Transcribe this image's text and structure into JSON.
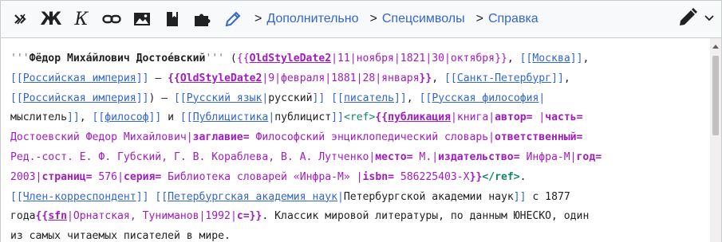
{
  "toolbar": {
    "tabs": [
      {
        "label": "Дополнительно"
      },
      {
        "label": "Спецсимволы"
      },
      {
        "label": "Справка"
      }
    ],
    "bold_label": "Ж",
    "italic_label": "К",
    "accent_color": "#3366cc"
  },
  "editor": {
    "l1": {
      "q_open": "'''",
      "bold_name": "Фёдор Миха́йлович Достое́вский",
      "q_close": "'''",
      "p_open": " (",
      "t1_open": "{{",
      "t1_name": "OldStyleDate2",
      "t1_args": "|11|ноября|1821|30|октября",
      "t1_close": "}}",
      "sep": ", ",
      "lk_open": "[[",
      "lk_text": "Москва",
      "lk_close": "]]",
      "end": ","
    },
    "l2": {
      "lk1_open": "[[",
      "lk1_text": "Российская империя",
      "lk1_close": "]]",
      "dash": " — ",
      "t_open": "{{",
      "t_name": "OldStyleDate2",
      "t_args": "|9|февраля|1881|28|января",
      "t_close": "}}",
      "sep": ", ",
      "lk2_open": "[[",
      "lk2_text": "Санкт-Петербург",
      "lk2_close": "]]",
      "end": ","
    },
    "l3": {
      "lk1_open": "[[",
      "lk1_text": "Российская империя",
      "lk1_close": "]]",
      "dash": ") — ",
      "lk2_open": "[[",
      "lk2_text": "Русский язык",
      "lk2_pipe": "|",
      "lk2_label": "русский",
      "lk2_close": "]]",
      "sep1": " ",
      "lk3_open": "[[",
      "lk3_text": "писатель",
      "lk3_close": "]]",
      "sep2": ", ",
      "lk4_open": "[[",
      "lk4_text": "Русская философия",
      "lk4_pipe": "|"
    },
    "l4": {
      "text1": "мыслитель",
      "lk1_close": "]]",
      "sep1": ", ",
      "lk2_open": "[[",
      "lk2_text": "философ",
      "lk2_close": "]]",
      "and": " и ",
      "lk3_open": "[[",
      "lk3_text": "Публицистика",
      "lk3_pipe": "|",
      "lk3_label": "публицист",
      "lk3_close": "]]",
      "ref_open": "<ref>",
      "t_open": "{{",
      "t_name": "публикация",
      "t_rest1": "|книга|",
      "p1": "автор=",
      "t_rest2": " |",
      "p2": "часть="
    },
    "l5": {
      "text1": "Достоевский Федор Михайлович",
      "pipe1": "|",
      "p1": "заглавие=",
      "text2": " Философский энциклопедический словарь",
      "pipe2": "|",
      "p2": "ответственный="
    },
    "l6": {
      "text1": "Ред.-сост. Е. Ф. Губский, Г. В. Кораблева, В. А. Лутченко",
      "pipe1": "|",
      "p1": "место=",
      "text2": " М.",
      "pipe2": "|",
      "p2": "издательство=",
      "text3": " Инфра-М",
      "pipe3": "|",
      "p3": "год="
    },
    "l7": {
      "text1": "2003",
      "pipe1": "|",
      "p1": "страниц=",
      "text2": " 576",
      "pipe2": "|",
      "p2": "серия=",
      "text3": " Библиотека словарей «Инфра-М» ",
      "pipe3": "|",
      "p3": "isbn=",
      "text4": " 586225403-X",
      "t_close": "}}",
      "ref_close": "</ref>",
      "end": "."
    },
    "l8": {
      "lk1_open": "[[",
      "lk1_text": "Член-корреспондент",
      "lk1_close": "]]",
      "sep": " ",
      "lk2_open": "[[",
      "lk2_text": "Петербургская академия наук",
      "lk2_pipe": "|",
      "lk2_label": "Петербургской академии наук",
      "lk2_close": "]]",
      "end": " с 1877"
    },
    "l9": {
      "text1": "года",
      "t_open": "{{",
      "t_name": "sfn",
      "t_args": "|Орнатская, Туниманов|1992|",
      "p1": "c=",
      "t_close": "}}",
      "end": ". Классик мировой литературы, по данным ЮНЕСКО, один"
    },
    "l10": {
      "text1": "из самых читаемых писателей в мире."
    }
  }
}
